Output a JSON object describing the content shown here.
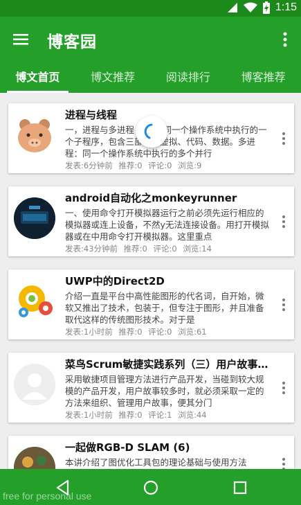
{
  "status_bar": {
    "time": "1:15"
  },
  "app_bar": {
    "title": "博客园"
  },
  "tabs": [
    {
      "label": "博文首页",
      "active": true
    },
    {
      "label": "博文推荐",
      "active": false
    },
    {
      "label": "阅读排行",
      "active": false
    },
    {
      "label": "博客推荐",
      "active": false
    }
  ],
  "posts": [
    {
      "title": "进程与线程",
      "summary": "一，进程与多进程 进程：同一个操作系统中执行的一个子程序，包含三部分：虚拟、代码、数据。多进程：同一个操作系统中执行的多个并行",
      "posted": "发表:6分钟前",
      "recommend": "推荐:0",
      "comments": "评论:0",
      "views": "浏览:9"
    },
    {
      "title": "android自动化之monkeyrunner",
      "summary": "一、使用命令打开模拟器运行之前必须先运行相应的模拟器或连上设备，不然y无法连接设备。用打开模拟器或在中用命令打开模拟器。这里重点",
      "posted": "发表:43分钟前",
      "recommend": "推荐:0",
      "comments": "评论:0",
      "views": "浏览:14"
    },
    {
      "title": "UWP中的Direct2D",
      "summary": "介绍一直是平台中高性能图形的代名词，自开始，微软又推出了技术，包装于，但专注于图形，并且准备取代这样的传统图形技术。对于是",
      "posted": "发表:1小时前",
      "recommend": "推荐:0",
      "comments": "评论:0",
      "views": "浏览:61"
    },
    {
      "title": "菜鸟Scrum敏捷实践系列（三）用户故事的组织",
      "summary": "采用敏捷项目管理方法进行产品开发，当碰到较大规模的产品开发，用户故事较多时，就必须采取一定的方法来组织、管理用户故事，便其分门",
      "posted": "发表:1小时前",
      "recommend": "推荐:0",
      "comments": "评论:1",
      "views": "浏览:44"
    },
    {
      "title": "一起做RGB-D SLAM (6)",
      "summary": "本讲介绍了图优化工具包的理论基础与使用方法",
      "posted": "",
      "recommend": "",
      "comments": "",
      "views": ""
    }
  ],
  "icons": {
    "menu": "menu-icon",
    "more": "more-vert-icon",
    "back": "back-triangle-icon",
    "home": "home-circle-icon",
    "recents": "recents-square-icon"
  },
  "watermark": "free for personal use",
  "colors": {
    "primary": "#24a02a",
    "status": "#1b8a1b",
    "spinner": "#1e88e5"
  }
}
